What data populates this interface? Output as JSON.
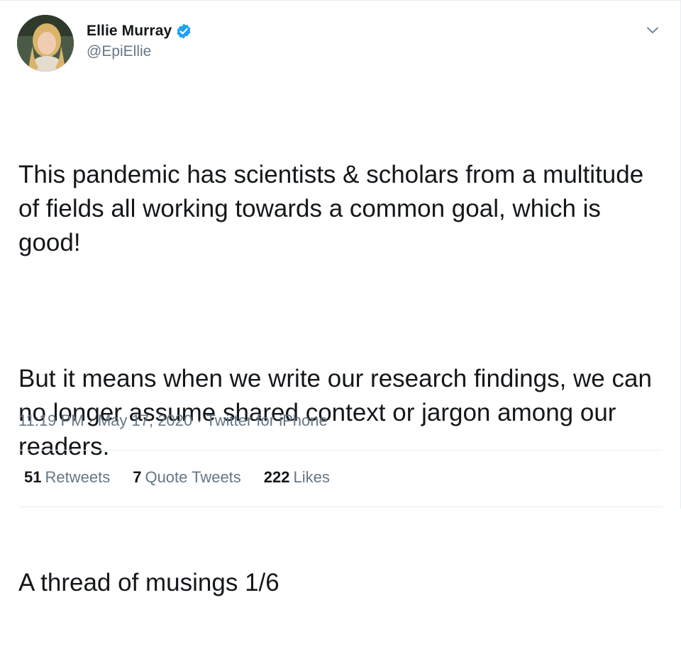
{
  "author": {
    "display_name": "Ellie Murray",
    "handle": "@EpiEllie",
    "verified": true
  },
  "tweet": {
    "paragraphs": [
      "This pandemic has scientists & scholars from a multitude of fields all working towards a common goal, which is good!",
      "But it means when we write our research findings, we can no longer assume shared context or jargon among our readers.",
      "A thread of musings 1/6"
    ]
  },
  "meta": {
    "time": "11:19 PM",
    "date": "May 17, 2020",
    "source": "Twitter for iPhone",
    "separator": "·"
  },
  "stats": {
    "retweets": {
      "count": "51",
      "label": "Retweets"
    },
    "quote_tweets": {
      "count": "7",
      "label": "Quote Tweets"
    },
    "likes": {
      "count": "222",
      "label": "Likes"
    }
  },
  "icons": {
    "verified": "verified-badge-icon",
    "caret": "chevron-down-icon"
  },
  "colors": {
    "text_primary": "#14171a",
    "text_secondary": "#657786",
    "verified_blue": "#1da1f2",
    "divider": "#e6ecf0"
  }
}
